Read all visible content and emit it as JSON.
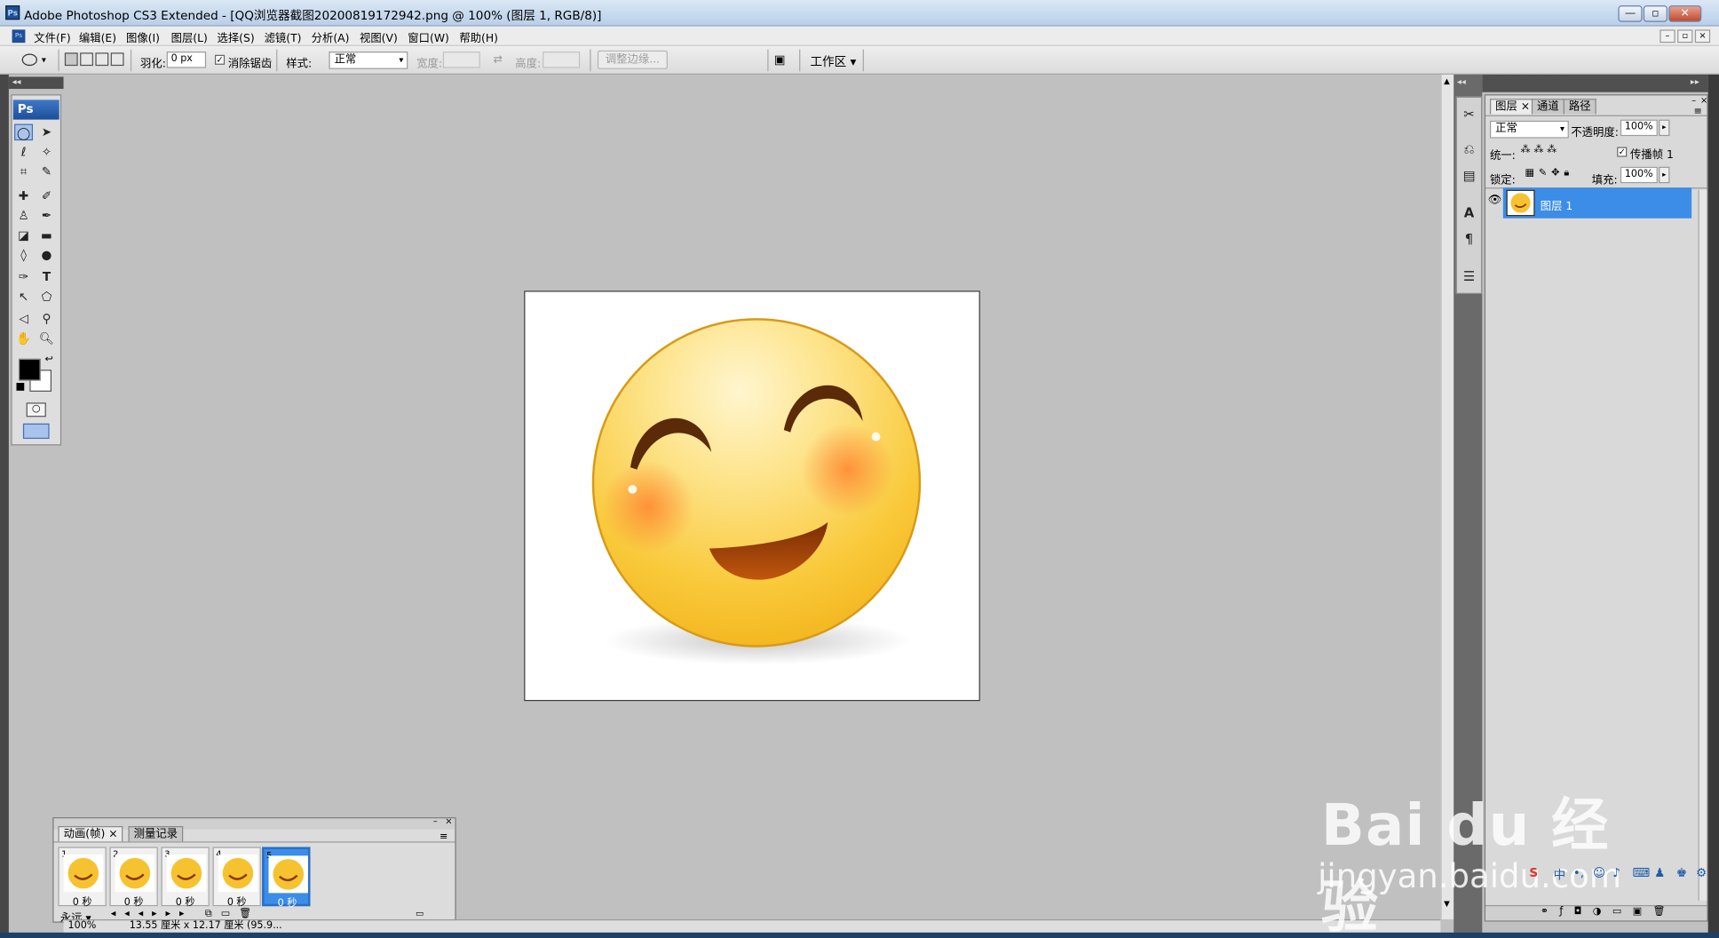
{
  "window": {
    "title": "Adobe Photoshop CS3 Extended - [QQ浏览器截图20200819172942.png @ 100% (图层 1, RGB/8)]",
    "app_icon_text": "Ps",
    "controls": [
      "—",
      "▫",
      "✕"
    ]
  },
  "menubar": {
    "items": [
      "文件(F)",
      "编辑(E)",
      "图像(I)",
      "图层(L)",
      "选择(S)",
      "滤镜(T)",
      "分析(A)",
      "视图(V)",
      "窗口(W)",
      "帮助(H)"
    ]
  },
  "options": {
    "feather_label": "羽化:",
    "feather_value": "0 px",
    "antialias_label": "消除锯齿",
    "style_label": "样式:",
    "style_value": "正常",
    "width_label": "宽度:",
    "height_label": "高度:",
    "refine_edge_label": "调整边缘...",
    "workspace_label": "工作区 ▾"
  },
  "toolbox": {
    "badge": "Ps",
    "foreground_color": "#000000",
    "background_color": "#ffffff"
  },
  "document": {
    "canvas_color": "#ffffff"
  },
  "layers_panel": {
    "tabs": [
      "图层",
      "通道",
      "路径"
    ],
    "blend_mode": "正常",
    "opacity_label": "不透明度:",
    "opacity_value": "100%",
    "unify_label": "统一:",
    "propagate_label": "传播帧 1",
    "lock_label": "锁定:",
    "fill_label": "填充:",
    "fill_value": "100%",
    "layers": [
      {
        "name": "图层 1",
        "visible": true,
        "selected": true
      }
    ]
  },
  "animation_panel": {
    "tabs": [
      "动画(帧)",
      "测量记录"
    ],
    "frames": [
      {
        "num": "1",
        "time": "0 秒"
      },
      {
        "num": "2",
        "time": "0 秒"
      },
      {
        "num": "3",
        "time": "0 秒"
      },
      {
        "num": "4",
        "time": "0 秒"
      },
      {
        "num": "5",
        "time": "0 秒",
        "selected": true
      }
    ],
    "loop_value": "永远"
  },
  "statusbar": {
    "zoom": "100%",
    "doc_info": "13.55 厘米 x 12.17 厘米 (95.9..."
  },
  "watermark": {
    "brand": "Bai du 经验",
    "url": "jingyan.baidu.com"
  },
  "colors": {
    "accent": "#3b8de8",
    "workspace": "#c0c0c0",
    "emoji_yellow": "#f7c230"
  }
}
